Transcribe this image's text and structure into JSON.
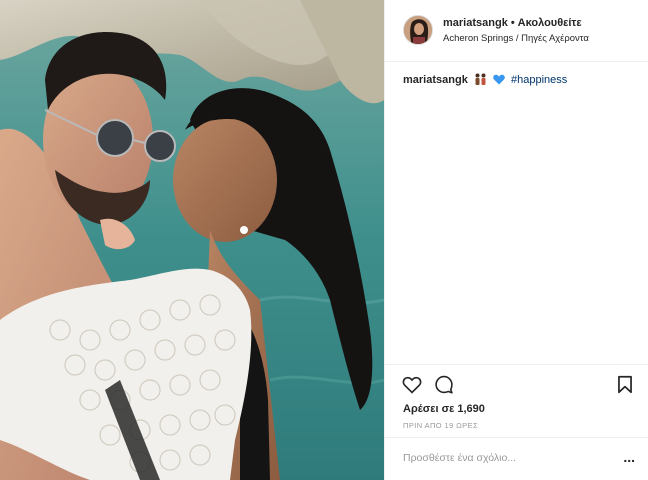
{
  "post": {
    "author": "mariatsangk",
    "separator": "•",
    "follow_state": "Ακολουθείτε",
    "location": "Acheron Springs / Πηγές Αχέροντα",
    "caption": {
      "user": "mariatsangk",
      "emojis": [
        "couple-emoji",
        "blue-heart-emoji"
      ],
      "hashtag": "#happiness"
    },
    "likes_text": "Αρέσει σε 1,690",
    "time_text": "ΠΡΙΝ ΑΠΟ 19 ΩΡΕΣ"
  },
  "comment": {
    "placeholder": "Προσθέστε ένα σχόλιο...",
    "more_label": "..."
  },
  "icons": {
    "like": "heart-outline-icon",
    "comment": "comment-bubble-icon",
    "save": "bookmark-icon",
    "more": "more-options-icon"
  },
  "colors": {
    "text": "#262626",
    "secondary": "#999999",
    "link": "#003569",
    "border": "#efefef",
    "heart_emoji": "#3897f0"
  }
}
